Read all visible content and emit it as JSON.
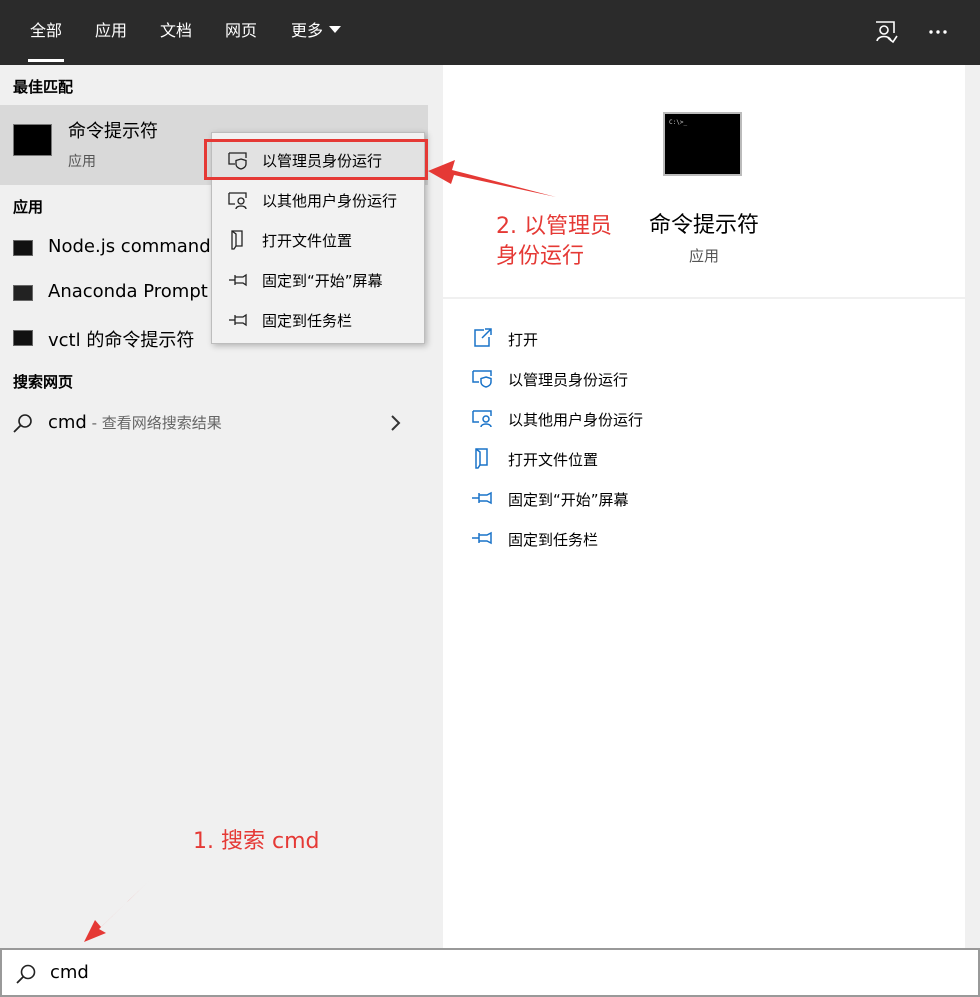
{
  "tabs": [
    {
      "label": "全部"
    },
    {
      "label": "应用"
    },
    {
      "label": "文档"
    },
    {
      "label": "网页"
    },
    {
      "label": "更多"
    }
  ],
  "left": {
    "best_match_header": "最佳匹配",
    "best_match": {
      "title": "命令提示符",
      "subtitle": "应用"
    },
    "apps_header": "应用",
    "apps": [
      {
        "label": "Node.js command"
      },
      {
        "label": "Anaconda Prompt"
      },
      {
        "label": "vctl 的命令提示符"
      }
    ],
    "web_header": "搜索网页",
    "web_item": {
      "query": "cmd",
      "suffix": " - 查看网络搜索结果"
    }
  },
  "context_menu": [
    {
      "label": "以管理员身份运行",
      "icon": "shield-window-icon"
    },
    {
      "label": "以其他用户身份运行",
      "icon": "user-window-icon"
    },
    {
      "label": "打开文件位置",
      "icon": "file-location-icon"
    },
    {
      "label": "固定到“开始”屏幕",
      "icon": "pin-icon"
    },
    {
      "label": "固定到任务栏",
      "icon": "pin-icon"
    }
  ],
  "right": {
    "title": "命令提示符",
    "subtitle": "应用",
    "actions": [
      {
        "label": "打开",
        "icon": "open-icon"
      },
      {
        "label": "以管理员身份运行",
        "icon": "shield-window-icon"
      },
      {
        "label": "以其他用户身份运行",
        "icon": "user-window-icon"
      },
      {
        "label": "打开文件位置",
        "icon": "file-location-icon"
      },
      {
        "label": "固定到“开始”屏幕",
        "icon": "pin-icon"
      },
      {
        "label": "固定到任务栏",
        "icon": "pin-icon"
      }
    ]
  },
  "search": {
    "value": "cmd"
  },
  "annotations": {
    "step2_line1": "2. 以管理员",
    "step2_line2": "身份运行",
    "step1": "1. 搜索 cmd"
  },
  "colors": {
    "topbar": "#2b2b2b",
    "accent_annotation": "#e53935",
    "icon_blue": "#1a73c8"
  }
}
